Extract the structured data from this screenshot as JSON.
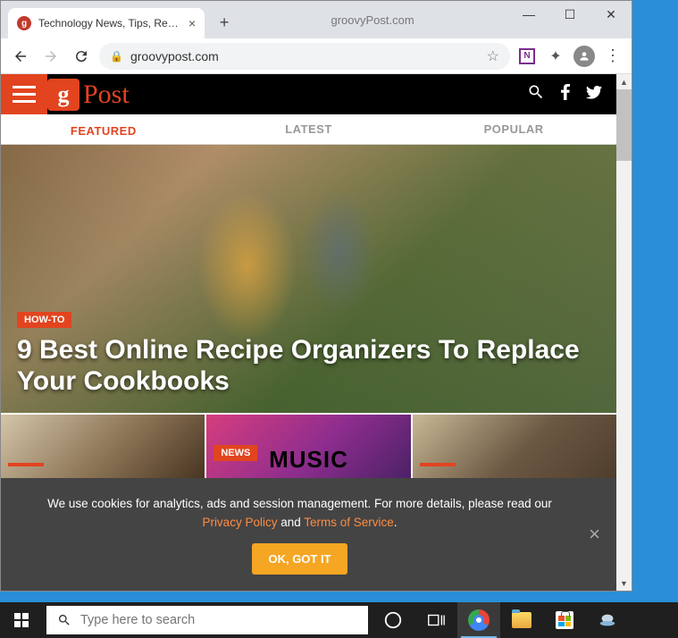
{
  "browser": {
    "tab_title": "Technology News, Tips, Reviews,",
    "title_center": "groovyPost.com",
    "url": "groovypost.com"
  },
  "site": {
    "logo_letter": "g",
    "logo_text": "Post",
    "tabs": [
      "FEATURED",
      "LATEST",
      "POPULAR"
    ]
  },
  "hero": {
    "badge": "HOW-TO",
    "title": "9 Best Online Recipe Organizers To Replace Your Cookbooks"
  },
  "thumbs": {
    "badge2": "NEWS",
    "music_text": "MUSIC"
  },
  "cookie": {
    "text1": "We use cookies for analytics, ads and session management. For more details, please read our ",
    "privacy": "Privacy Policy",
    "and": " and ",
    "tos": "Terms of Service",
    "dot": ".",
    "button": "OK, GOT IT"
  },
  "taskbar": {
    "search_placeholder": "Type here to search"
  }
}
